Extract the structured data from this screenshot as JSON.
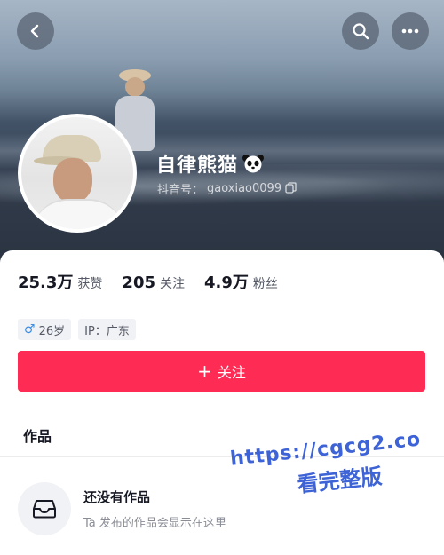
{
  "header": {
    "back_icon": "back-chevron-icon",
    "search_icon": "search-icon",
    "more_icon": "more-dots-icon"
  },
  "profile": {
    "name": "自律熊猫",
    "name_emoji_icon": "panda-icon",
    "id_label": "抖音号：",
    "id_value": "gaoxiao0099",
    "copy_icon": "copy-icon"
  },
  "stats": [
    {
      "value": "25.3万",
      "label": "获赞"
    },
    {
      "value": "205",
      "label": "关注"
    },
    {
      "value": "4.9万",
      "label": "粉丝"
    }
  ],
  "tags": {
    "age": "26岁",
    "ip": "IP：广东"
  },
  "follow_button": {
    "plus": "+",
    "label": "关注"
  },
  "tabs": {
    "works": "作品"
  },
  "empty_state": {
    "icon": "inbox-icon",
    "title": "还没有作品",
    "subtitle": "Ta 发布的作品会显示在这里"
  },
  "watermark": {
    "url": "https://cgcg2.co",
    "text": "看完整版"
  },
  "colors": {
    "accent": "#fe2c55",
    "male_blue": "#3a8ee6",
    "watermark_blue": "#3d63d6"
  }
}
